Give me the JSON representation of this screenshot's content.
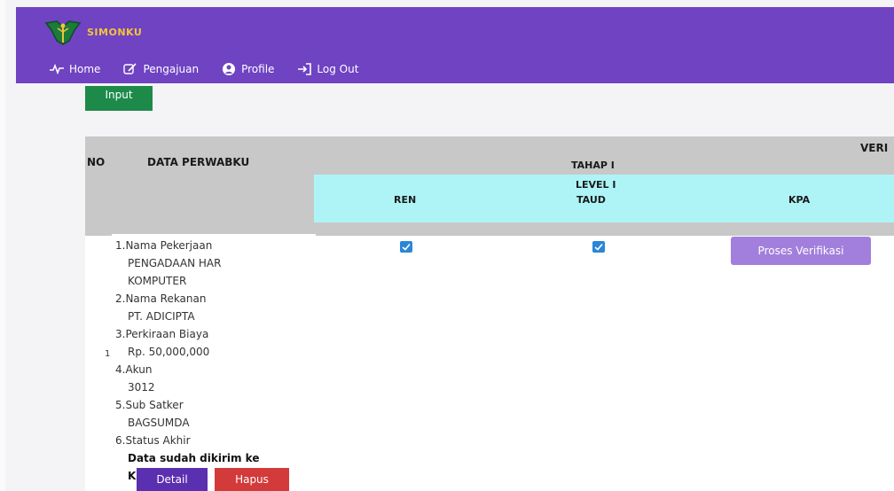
{
  "app": {
    "brand": "SIMONKU"
  },
  "nav": {
    "home": "Home",
    "pengajuan": "Pengajuan",
    "profile": "Profile",
    "logout": "Log Out"
  },
  "actions": {
    "input_label": "Input"
  },
  "table": {
    "col_no": "NO",
    "col_data": "DATA PERWABKU",
    "col_verif_partial": "VERI",
    "tahap": "TAHAP I",
    "level": "LEVEL I",
    "col_ren": "REN",
    "col_taud": "TAUD",
    "col_kpa": "KPA",
    "rows": [
      {
        "no": "1",
        "details": [
          {
            "num": "1.",
            "label": "Nama Pekerjaan",
            "value_lines": [
              "PENGADAAN HAR",
              "KOMPUTER"
            ]
          },
          {
            "num": "2.",
            "label": "Nama Rekanan",
            "value_lines": [
              "PT. ADICIPTA"
            ]
          },
          {
            "num": "3.",
            "label": "Perkiraan Biaya",
            "value_lines": [
              "Rp. 50,000,000"
            ]
          },
          {
            "num": "4.",
            "label": "Akun",
            "value_lines": [
              "3012"
            ]
          },
          {
            "num": "5.",
            "label": "Sub Satker",
            "value_lines": [
              "BAGSUMDA"
            ]
          },
          {
            "num": "6.",
            "label": "Status Akhir",
            "value_lines": []
          }
        ],
        "status_lines": [
          "Data sudah dikirim ke",
          "KPA"
        ],
        "ren_checked": true,
        "taud_checked": true,
        "kpa_button": "Proses Verifikasi",
        "detail_button": "Detail",
        "hapus_button": "Hapus"
      }
    ]
  }
}
